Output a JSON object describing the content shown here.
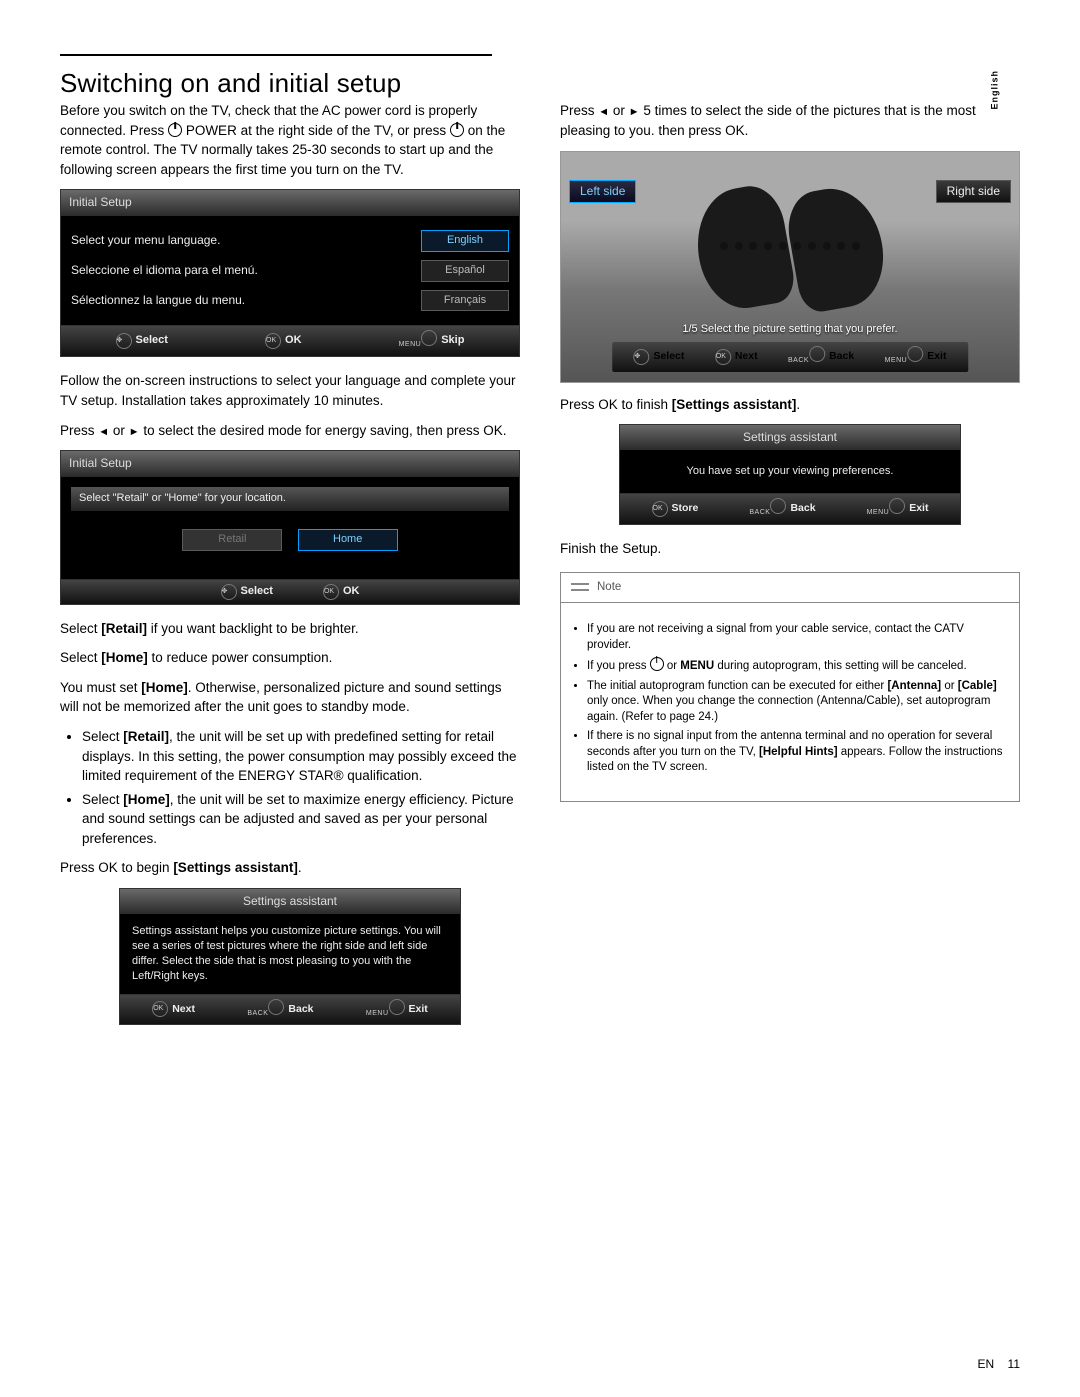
{
  "lang_tab": "English",
  "heading": "Switching on and initial setup",
  "intro": {
    "p1a": "Before you switch on the TV, check that the AC power cord is properly connected. Press ",
    "p1b": " POWER at the right side of the TV, or press ",
    "p1c": " on the remote control. The TV normally takes 25-30 seconds to start up and the following screen appears the first time you turn on the TV."
  },
  "osd1": {
    "title": "Initial Setup",
    "r1": "Select your menu language.",
    "b1": "English",
    "r2": "Seleccione el idioma para el menú.",
    "b2": "Español",
    "r3": "Sélectionnez la langue du menu.",
    "b3": "Français",
    "foot": {
      "select": "Select",
      "ok_ic": "OK",
      "ok": "OK",
      "menu": "MENU",
      "skip": "Skip"
    }
  },
  "after1": "Follow the on-screen instructions to select your language and complete your TV setup. Installation takes approximately 10 minutes.",
  "press_mode_a": "Press ",
  "press_mode_b": " to select the desired mode for energy saving, then press OK.",
  "osd2": {
    "title": "Initial Setup",
    "prompt": "Select \"Retail\" or \"Home\" for your location.",
    "retail": "Retail",
    "home": "Home",
    "foot": {
      "select": "Select",
      "ok": "OK",
      "ok_ic": "OK"
    }
  },
  "after2": {
    "l1a": "Select ",
    "l1b": "[Retail]",
    "l1c": " if you want backlight to be brighter.",
    "l2a": "Select ",
    "l2b": "[Home]",
    "l2c": " to reduce power consumption.",
    "l3a": "You must set ",
    "l3b": "[Home]",
    "l3c": ". Otherwise, personalized picture and sound settings will not be memorized after the unit goes to standby mode.",
    "b1a": "Select ",
    "b1b": "[Retail]",
    "b1c": ", the unit will be set up with predefined setting for retail displays. In this setting, the power consumption may possibly exceed the limited requirement of the ENERGY STAR® qualification.",
    "b2a": "Select ",
    "b2b": "[Home]",
    "b2c": ", the unit will be set to maximize energy efficiency. Picture and sound settings can be adjusted and saved as per your personal preferences."
  },
  "press_begin_a": "Press OK to begin ",
  "press_begin_b": "[Settings assistant]",
  "press_begin_c": ".",
  "osd3": {
    "title": "Settings assistant",
    "body": "Settings assistant helps you customize picture settings. You will see a series of test pictures where the right side and left side differ. Select the side that is most pleasing to you with the Left/Right keys.",
    "foot": {
      "ok_ic": "OK",
      "next": "Next",
      "back_t": "BACK",
      "back": "Back",
      "menu_t": "MENU",
      "exit": "Exit"
    }
  },
  "col2_top_a": "Press ",
  "col2_top_b": " 5 times to select the side of the pictures that is the most pleasing to you. then press OK.",
  "pic": {
    "left": "Left side",
    "right": "Right side",
    "banner": "1/5 Select the picture setting that you prefer.",
    "foot": {
      "select": "Select",
      "ok_ic": "OK",
      "next": "Next",
      "back_t": "BACK",
      "back": "Back",
      "menu_t": "MENU",
      "exit": "Exit"
    }
  },
  "press_finish_a": "Press OK to finish ",
  "press_finish_b": "[Settings assistant]",
  "press_finish_c": ".",
  "osd4": {
    "title": "Settings assistant",
    "body": "You have set up your viewing preferences.",
    "foot": {
      "ok_ic": "OK",
      "store": "Store",
      "back_t": "BACK",
      "back": "Back",
      "menu_t": "MENU",
      "exit": "Exit"
    }
  },
  "finish": "Finish the Setup.",
  "note": {
    "label": "Note",
    "i1": "If you are not receiving a signal from your cable service, contact the CATV provider.",
    "i2a": "If you press ",
    "i2b": " or ",
    "i2c": "MENU",
    "i2d": " during autoprogram, this setting will be canceled.",
    "i3a": "The initial autoprogram function can be executed for either ",
    "i3b": "[Antenna]",
    "i3c": " or ",
    "i3d": "[Cable]",
    "i3e": " only once. When you change the connection (Antenna/Cable), set autoprogram again. (Refer to page 24.)",
    "i4a": "If there is no signal input from the antenna terminal and no operation for several seconds after you turn on the TV, ",
    "i4b": "[Helpful Hints]",
    "i4c": " appears. Follow the instructions listed on the TV screen."
  },
  "footer": {
    "lang": "EN",
    "page": "11"
  }
}
